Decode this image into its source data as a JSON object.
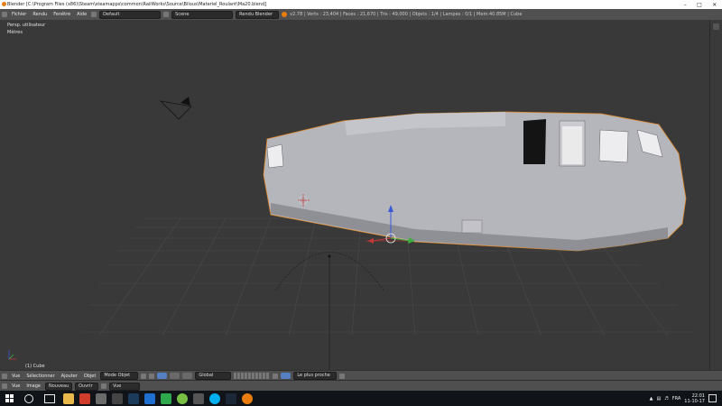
{
  "window": {
    "title": "Blender [C:\\Program Files (x86)\\Steam\\steamapps\\common\\RailWorks\\Source\\Bilous\\Materiel_Roulant\\Ma20.blend]",
    "icon": "blender-icon"
  },
  "top_bar": {
    "menus": [
      "Fichier",
      "Rendu",
      "Fenêtre",
      "Aide"
    ],
    "layout": "Default",
    "scene": "Scene",
    "engine": "Rendu Blender",
    "stats": "v2.78 | Verts : 23,404 | Faces : 21,670 | Tris : 49,000 | Objets : 1/4 | Lampes : 0/1 | Mem:40.85M | Cube"
  },
  "viewport": {
    "view_name": "Persp. utilisateur",
    "units": "Mètres",
    "selected_object": "(1) Cube"
  },
  "bottom_header": {
    "menus": [
      "Vue",
      "Sélectionner",
      "Ajouter",
      "Objet"
    ],
    "mode": "Mode Objet",
    "orientation": "Global",
    "snap": "Le plus proche"
  },
  "timeline_header": {
    "menus": [
      "Vue",
      "Image"
    ],
    "buttons": [
      "Nouveau",
      "Ouvrir"
    ],
    "view_select": "Vue"
  },
  "taskbar": {
    "language": "FRA",
    "time": "22:01",
    "date": "11-10-17"
  }
}
